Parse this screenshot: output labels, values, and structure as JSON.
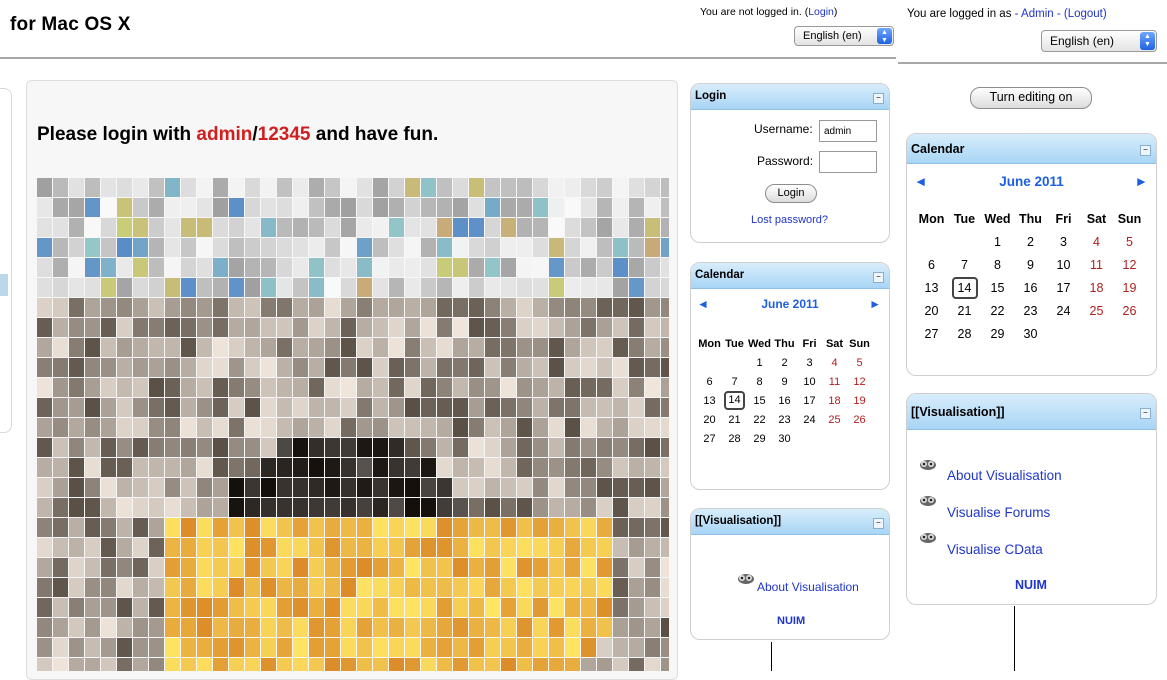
{
  "left_header": {
    "site_title": "for Mac OS X",
    "login_status_prefix": "You are not logged in. (",
    "login_link": "Login",
    "login_status_suffix": ")",
    "language": "English (en)"
  },
  "right_header": {
    "login_status_prefix": "You are logged in as",
    "user_link": "- Admin -",
    "logout_link": "(Logout)",
    "language": "English (en)",
    "edit_button": "Turn editing on"
  },
  "main": {
    "welcome_prefix": "Please login with ",
    "username_hint": "admin",
    "separator": "/",
    "password_hint": "12345",
    "welcome_suffix": " and have fun."
  },
  "login_block": {
    "title": "Login",
    "username_label": "Username:",
    "username_value": "admin",
    "password_label": "Password:",
    "login_button": "Login",
    "lost_password": "Lost password?"
  },
  "calendar": {
    "title": "Calendar",
    "month": "June 2011",
    "prev": "◄",
    "next": "►",
    "weekdays": [
      "Mon",
      "Tue",
      "Wed",
      "Thu",
      "Fri",
      "Sat",
      "Sun"
    ],
    "weeks": [
      [
        "",
        "",
        "1",
        "2",
        "3",
        "4",
        "5"
      ],
      [
        "6",
        "7",
        "8",
        "9",
        "10",
        "11",
        "12"
      ],
      [
        "13",
        "14",
        "15",
        "16",
        "17",
        "18",
        "19"
      ],
      [
        "20",
        "21",
        "22",
        "23",
        "24",
        "25",
        "26"
      ],
      [
        "27",
        "28",
        "29",
        "30",
        "",
        "",
        ""
      ]
    ],
    "today": "14"
  },
  "vis_small": {
    "title": "[[Visualisation]]",
    "links": [
      "About Visualisation"
    ],
    "footer": "NUIM"
  },
  "vis_large": {
    "title": "[[Visualisation]]",
    "links": [
      "About Visualisation",
      "Visualise Forums",
      "Visualise CData"
    ],
    "footer": "NUIM"
  },
  "colors": {
    "accent_red": "#d11f1f",
    "link_blue": "#1f35c8",
    "block_header": "#a8d5f5",
    "weekend_red": "#b01e1e"
  },
  "icons": [
    "collapse-toggle-icon",
    "visualisation-icon",
    "select-arrows-icon"
  ]
}
